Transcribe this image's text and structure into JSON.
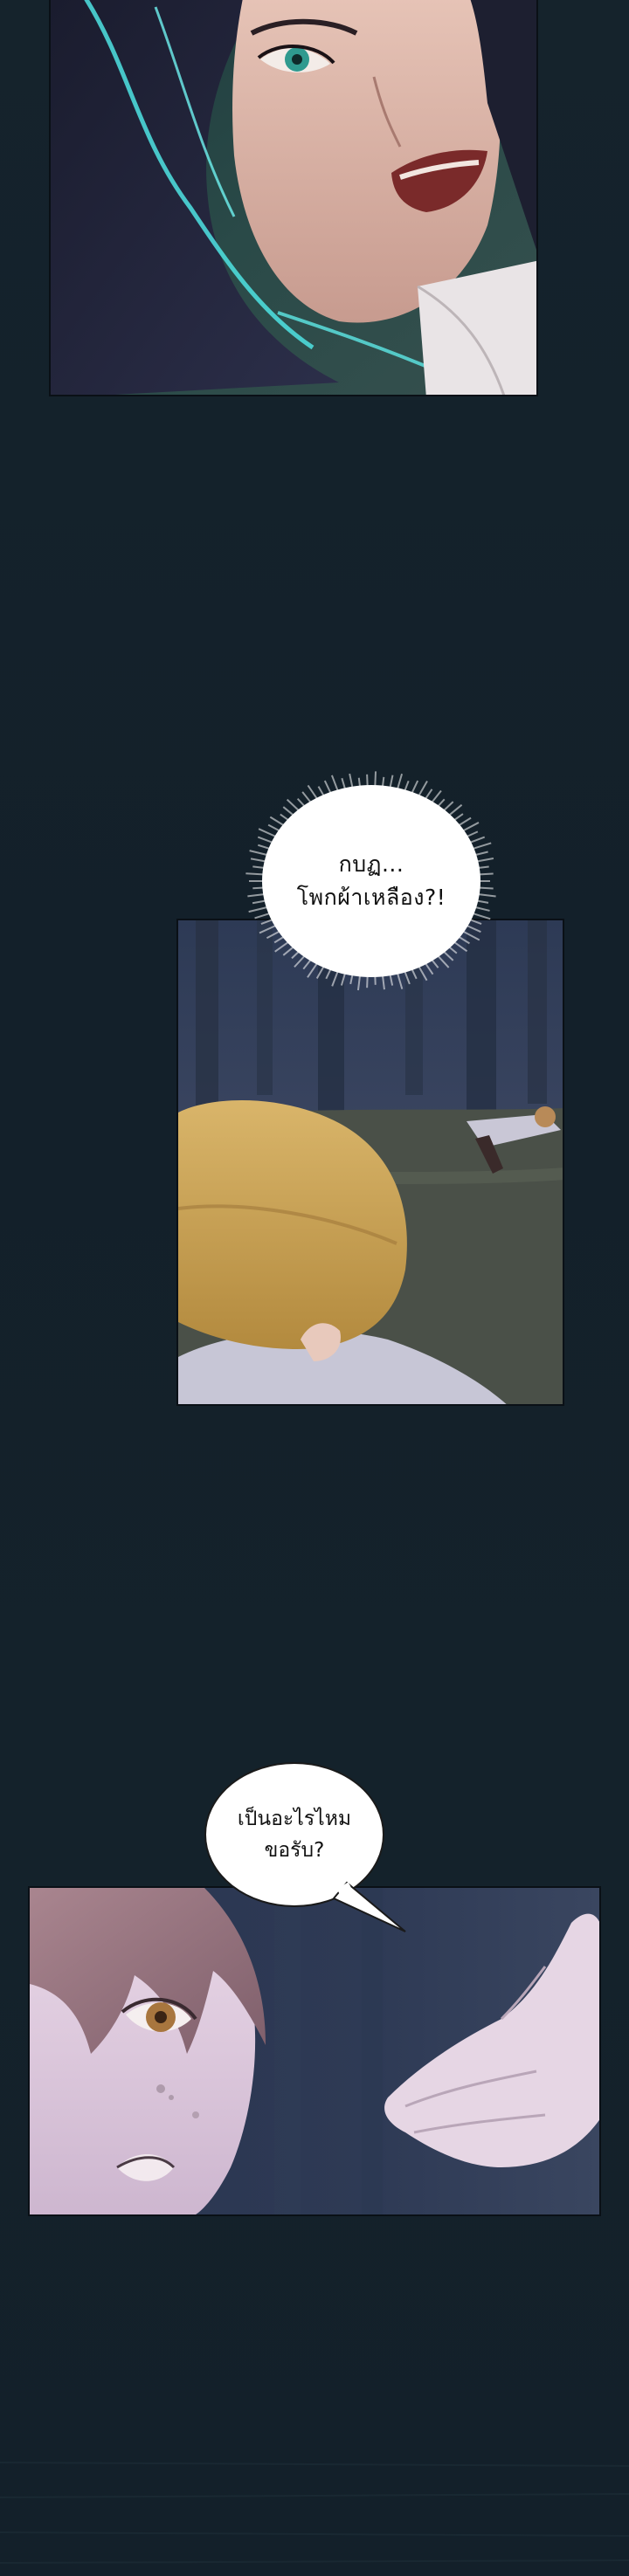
{
  "colors": {
    "page_background": "#14212a",
    "bubble_fill": "#ffffff",
    "bubble_text": "#111111"
  },
  "panels": [
    {
      "subject": "man-face-closeup"
    },
    {
      "subject": "boy-watching-body-in-forest"
    },
    {
      "subject": "boy-face-with-hand"
    }
  ],
  "bubbles": {
    "burst": {
      "line1": "กบฏ...",
      "line2": "โพกผ้าเหลือง?!"
    },
    "speech": {
      "line1": "เป็นอะไรไหม",
      "line2": "ขอรับ?"
    }
  }
}
